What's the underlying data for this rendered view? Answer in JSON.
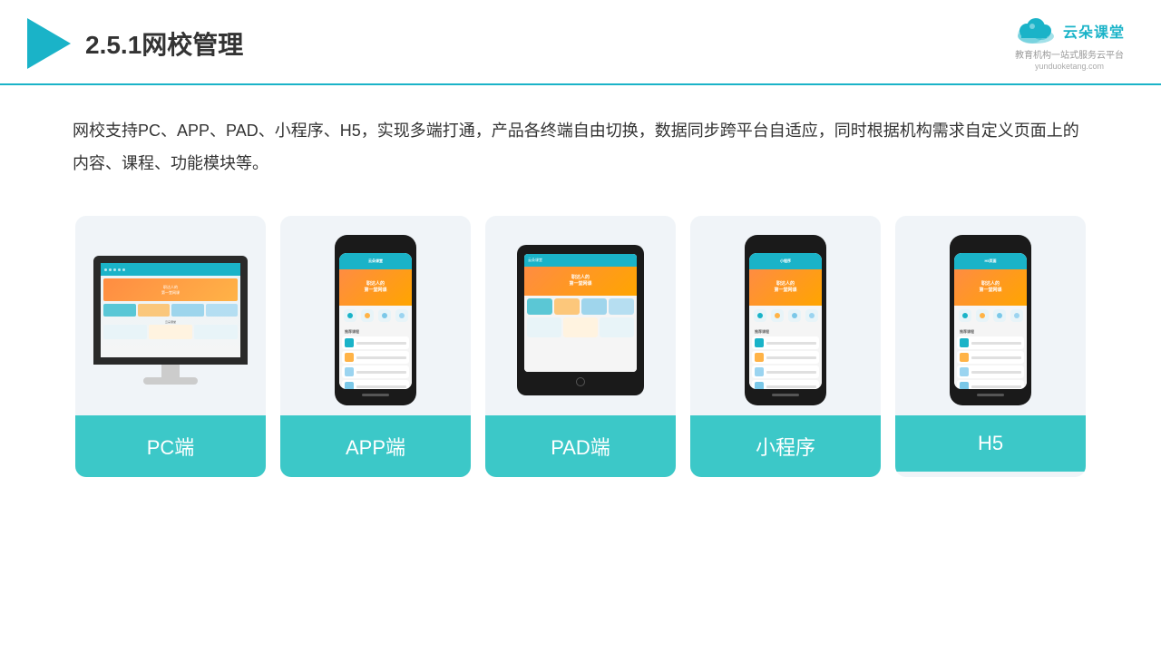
{
  "header": {
    "title": "2.5.1网校管理",
    "brand": {
      "name": "云朵课堂",
      "subtitle": "教育机构一站式服务云平台",
      "url": "yunduoketang.com"
    }
  },
  "description": {
    "text": "网校支持PC、APP、PAD、小程序、H5，实现多端打通，产品各终端自由切换，数据同步跨平台自适应，同时根据机构需求自定义页面上的内容、课程、功能模块等。"
  },
  "cards": [
    {
      "id": "pc",
      "label": "PC端",
      "type": "pc"
    },
    {
      "id": "app",
      "label": "APP端",
      "type": "phone"
    },
    {
      "id": "pad",
      "label": "PAD端",
      "type": "tablet"
    },
    {
      "id": "miniprogram",
      "label": "小程序",
      "type": "phone"
    },
    {
      "id": "h5",
      "label": "H5",
      "type": "phone"
    }
  ],
  "colors": {
    "primary": "#1ab3c8",
    "card_label_bg": "#3cc8c8",
    "card_bg": "#f0f4f8"
  }
}
